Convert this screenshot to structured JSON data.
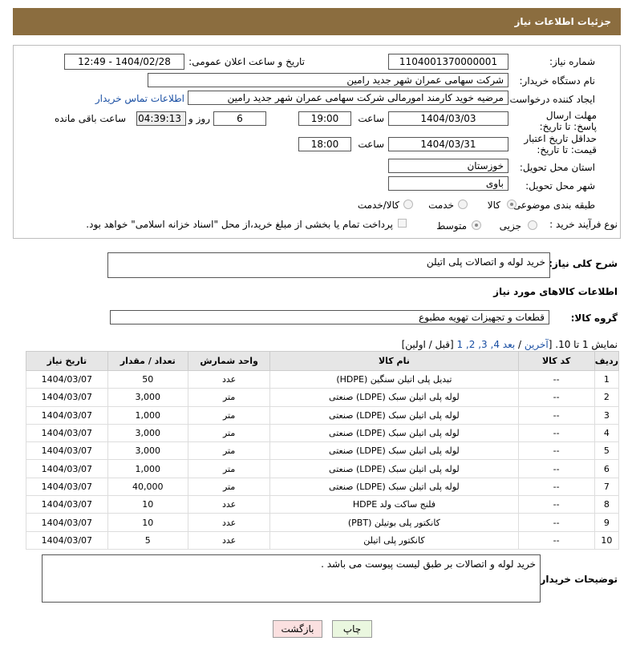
{
  "header": {
    "title": "جزئیات اطلاعات نیاز"
  },
  "need_number": {
    "label": "شماره نیاز:",
    "value": "1104001370000001"
  },
  "announce": {
    "label": "تاریخ و ساعت اعلان عمومی:",
    "value": "1404/02/28 - 12:49"
  },
  "buyer_org": {
    "label": "نام دستگاه خریدار:",
    "value": "شرکت سهامی عمران شهر جدید رامین"
  },
  "requester": {
    "label": "ایجاد کننده درخواست:",
    "value": "مرضیه خوید کارمند امورمالی شرکت سهامی عمران شهر جدید رامین",
    "contact_link": "اطلاعات تماس خریدار"
  },
  "deadline": {
    "label": "مهلت ارسال پاسخ: تا تاریخ:",
    "date": "1404/03/03",
    "time_label": "ساعت",
    "time": "19:00",
    "days": "6",
    "days_label": "روز و",
    "remaining": "04:39:13",
    "remaining_label": "ساعت باقی مانده"
  },
  "min_validity": {
    "label": "حداقل تاریخ اعتبار قیمت: تا تاریخ:",
    "date": "1404/03/31",
    "time_label": "ساعت",
    "time": "18:00"
  },
  "province": {
    "label": "استان محل تحویل:",
    "value": "خوزستان"
  },
  "city": {
    "label": "شهر محل تحویل:",
    "value": "باوی"
  },
  "category": {
    "label": "طبقه بندی موضوعی:",
    "opt_goods": "کالا",
    "opt_service": "خدمت",
    "opt_both": "کالا/خدمت"
  },
  "process": {
    "label": "نوع فرآیند خرید :",
    "opt_partial": "جزیی",
    "opt_medium": "متوسط",
    "note": "پرداخت تمام یا بخشی از مبلغ خرید،از محل \"اسناد خزانه اسلامی\" خواهد بود."
  },
  "description": {
    "label": "شرح کلی نیاز:",
    "value": "خرید لوله و اتصالات پلی اتیلن"
  },
  "items_title": "اطلاعات کالاهای مورد نیاز",
  "goods_group": {
    "label": "گروه کالا:",
    "value": "قطعات و تجهیزات تهویه مطبوع"
  },
  "pagination": {
    "prefix": "نمایش 1 تا 10. [",
    "last": "آخرین",
    "sep": " / ",
    "next": "بعد",
    "pages": "4, 3, 2, 1",
    "suffix": "[قبل / اولین]"
  },
  "table": {
    "headers": [
      "ردیف",
      "کد کالا",
      "نام کالا",
      "واحد شمارش",
      "تعداد / مقدار",
      "تاریخ نیاز"
    ],
    "rows": [
      [
        "1",
        "--",
        "تبدیل پلی اتیلن سنگین (HDPE)",
        "عدد",
        "50",
        "1404/03/07"
      ],
      [
        "2",
        "--",
        "لوله پلی اتیلن سبک (LDPE) صنعتی",
        "متر",
        "3,000",
        "1404/03/07"
      ],
      [
        "3",
        "--",
        "لوله پلی اتیلن سبک (LDPE) صنعتی",
        "متر",
        "1,000",
        "1404/03/07"
      ],
      [
        "4",
        "--",
        "لوله پلی اتیلن سبک (LDPE) صنعتی",
        "متر",
        "3,000",
        "1404/03/07"
      ],
      [
        "5",
        "--",
        "لوله پلی اتیلن سبک (LDPE) صنعتی",
        "متر",
        "3,000",
        "1404/03/07"
      ],
      [
        "6",
        "--",
        "لوله پلی اتیلن سبک (LDPE) صنعتی",
        "متر",
        "1,000",
        "1404/03/07"
      ],
      [
        "7",
        "--",
        "لوله پلی اتیلن سبک (LDPE) صنعتی",
        "متر",
        "40,000",
        "1404/03/07"
      ],
      [
        "8",
        "--",
        "فلنج ساکت ولد HDPE",
        "عدد",
        "10",
        "1404/03/07"
      ],
      [
        "9",
        "--",
        "کانکتور پلی بوتیلن (PBT)",
        "عدد",
        "10",
        "1404/03/07"
      ],
      [
        "10",
        "--",
        "کانکتور پلی اتیلن",
        "عدد",
        "5",
        "1404/03/07"
      ]
    ]
  },
  "buyer_notes": {
    "label": "توضیحات خریدار:",
    "value": "خرید لوله و اتصالات بر طبق لیست پیوست می باشد ."
  },
  "buttons": {
    "print": "چاپ",
    "back": "بازگشت"
  }
}
